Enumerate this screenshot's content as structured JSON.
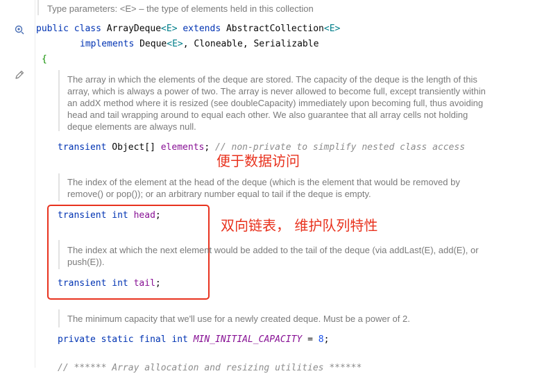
{
  "editor": {
    "type_params_doc": "Type parameters: <E> – the type of elements held in this collection",
    "class_decl": {
      "public": "public",
      "class": "class",
      "name": "ArrayDeque",
      "generic": "<E>",
      "extends": "extends",
      "super": "AbstractCollection",
      "super_generic": "<E>",
      "implements": "implements",
      "iface1": "Deque",
      "iface1_generic": "<E>",
      "rest": ", Cloneable, Serializable"
    },
    "open_brace": "{",
    "elements_doc": "The array in which the elements of the deque are stored. The capacity of the deque is the length of this array, which is always a power of two. The array is never allowed to become full, except transiently within an addX method where it is resized (see doubleCapacity) immediately upon becoming full, thus avoiding head and tail wrapping around to equal each other. We also guarantee that all array cells not holding deque elements are always null.",
    "elements_decl": {
      "modifier": "transient",
      "type": "Object[]",
      "name": "elements",
      "semicolon": ";",
      "comment": "// non-private to simplify nested class access"
    },
    "head_doc": "The index of the element at the head of the deque (which is the element that would be removed by remove() or pop()); or an arbitrary number equal to tail if the deque is empty.",
    "head_decl": {
      "modifier": "transient",
      "type": "int",
      "name": "head",
      "semicolon": ";"
    },
    "tail_doc": "The index at which the next element would be added to the tail of the deque (via addLast(E), add(E), or push(E)).",
    "tail_decl": {
      "modifier": "transient",
      "type": "int",
      "name": "tail",
      "semicolon": ";"
    },
    "min_doc": "The minimum capacity that we'll use for a newly created deque. Must be a power of 2.",
    "min_decl": {
      "private": "private",
      "static": "static",
      "final": "final",
      "type": "int",
      "name": "MIN_INITIAL_CAPACITY",
      "eq": " = ",
      "value": "8",
      "semicolon": ";"
    },
    "partial_comment": "// ****** Array allocation and resizing utilities ******"
  },
  "annotations": {
    "data_access": "便于数据访问",
    "linked_list": "双向链表， 维护队列特性",
    "accent_color": "#e8321e"
  },
  "gutter_icons": [
    "implemented-by-icon",
    "edit-pencil-icon"
  ]
}
